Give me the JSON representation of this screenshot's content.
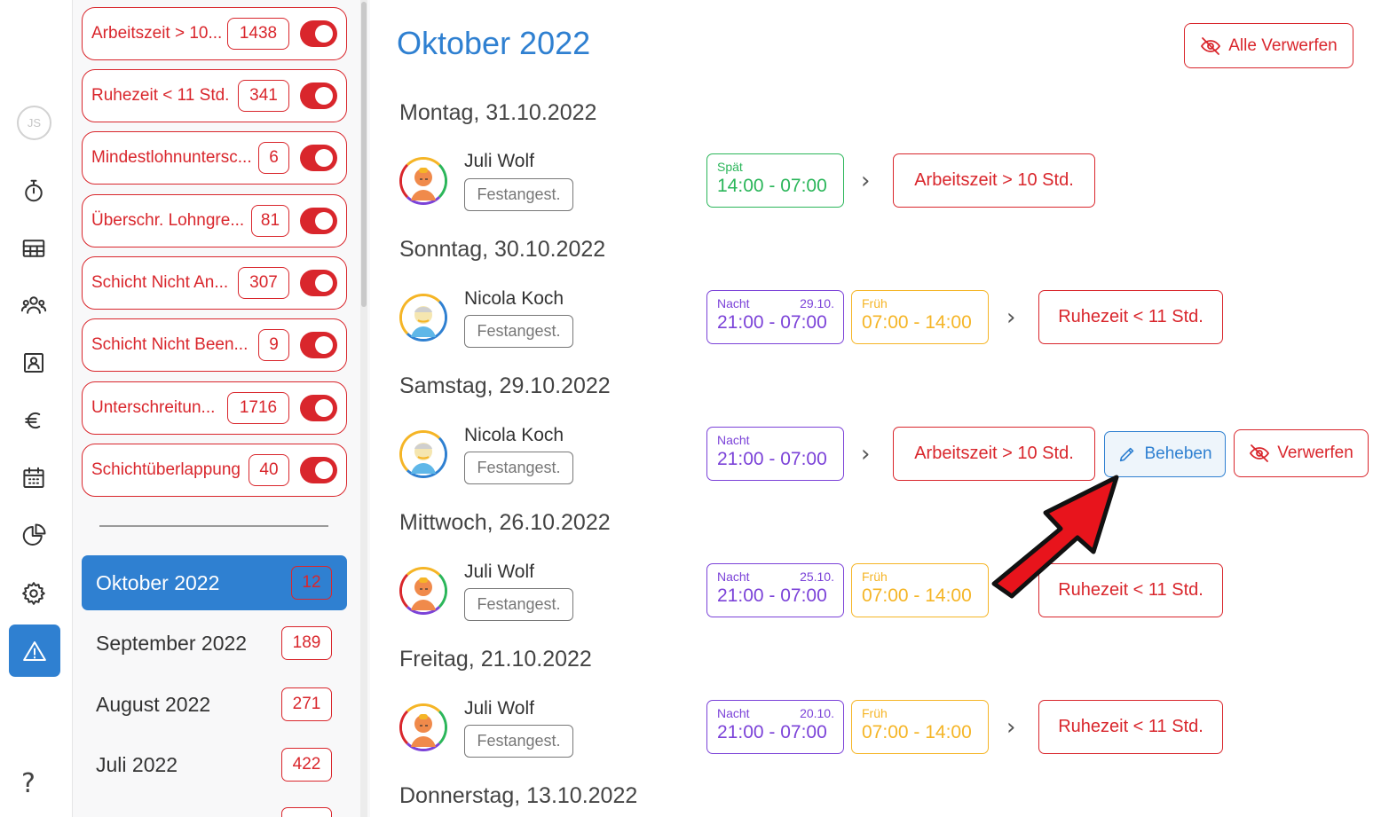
{
  "nav": {
    "user_initials": "JS",
    "icons": [
      "stopwatch-icon",
      "table-icon",
      "team-icon",
      "contact-card-icon",
      "euro-icon",
      "calendar-icon",
      "pie-chart-icon",
      "gear-icon",
      "warning-icon"
    ],
    "active": "warning-icon",
    "help": "?"
  },
  "filters": [
    {
      "label": "Arbeitszeit > 10...",
      "count": "1438",
      "enabled": true
    },
    {
      "label": "Ruhezeit < 11 Std.",
      "count": "341",
      "enabled": true
    },
    {
      "label": "Mindestlohnuntersc...",
      "count": "6",
      "enabled": true
    },
    {
      "label": "Überschr. Lohngre...",
      "count": "81",
      "enabled": true
    },
    {
      "label": "Schicht Nicht An...",
      "count": "307",
      "enabled": true
    },
    {
      "label": "Schicht Nicht Been...",
      "count": "9",
      "enabled": true
    },
    {
      "label": "Unterschreitun...",
      "count": "1716",
      "enabled": true
    },
    {
      "label": "Schichtüberlappung",
      "count": "40",
      "enabled": true
    }
  ],
  "months": [
    {
      "label": "Oktober 2022",
      "count": "12",
      "active": true
    },
    {
      "label": "September 2022",
      "count": "189"
    },
    {
      "label": "August 2022",
      "count": "271"
    },
    {
      "label": "Juli 2022",
      "count": "422"
    }
  ],
  "main": {
    "title": "Oktober 2022",
    "discard_all": "Alle Verwerfen",
    "fix_label": "Beheben",
    "discard_label": "Verwerfen",
    "days": [
      {
        "label": "Montag, 31.10.2022",
        "employee": "Juli Wolf",
        "tag": "Festangest.",
        "shifts": [
          {
            "type": "Spät",
            "date": "",
            "time": "14:00 - 07:00",
            "kind": "spaet"
          }
        ],
        "violation": "Arbeitszeit > 10 Std."
      },
      {
        "label": "Sonntag, 30.10.2022",
        "employee": "Nicola Koch",
        "tag": "Festangest.",
        "shifts": [
          {
            "type": "Nacht",
            "date": "29.10.",
            "time": "21:00 - 07:00",
            "kind": "nacht"
          },
          {
            "type": "Früh",
            "date": "",
            "time": "07:00 - 14:00",
            "kind": "frueh"
          }
        ],
        "violation": "Ruhezeit < 11 Std."
      },
      {
        "label": "Samstag, 29.10.2022",
        "employee": "Nicola Koch",
        "tag": "Festangest.",
        "shifts": [
          {
            "type": "Nacht",
            "date": "",
            "time": "21:00 - 07:00",
            "kind": "nacht"
          }
        ],
        "violation": "Arbeitszeit > 10 Std."
      },
      {
        "label": "Mittwoch, 26.10.2022",
        "employee": "Juli Wolf",
        "tag": "Festangest.",
        "shifts": [
          {
            "type": "Nacht",
            "date": "25.10.",
            "time": "21:00 - 07:00",
            "kind": "nacht"
          },
          {
            "type": "Früh",
            "date": "",
            "time": "07:00 - 14:00",
            "kind": "frueh"
          }
        ],
        "violation": "Ruhezeit < 11 Std."
      },
      {
        "label": "Freitag, 21.10.2022",
        "employee": "Juli Wolf",
        "tag": "Festangest.",
        "shifts": [
          {
            "type": "Nacht",
            "date": "20.10.",
            "time": "21:00 - 07:00",
            "kind": "nacht"
          },
          {
            "type": "Früh",
            "date": "",
            "time": "07:00 - 14:00",
            "kind": "frueh"
          }
        ],
        "violation": "Ruhezeit < 11 Std."
      },
      {
        "label": "Donnerstag, 13.10.2022"
      }
    ]
  },
  "colors": {
    "accent": "#2f80d1",
    "danger": "#d9262c",
    "spaet": "#2bb65a",
    "nacht": "#7b42d8",
    "frueh": "#f5b526"
  }
}
